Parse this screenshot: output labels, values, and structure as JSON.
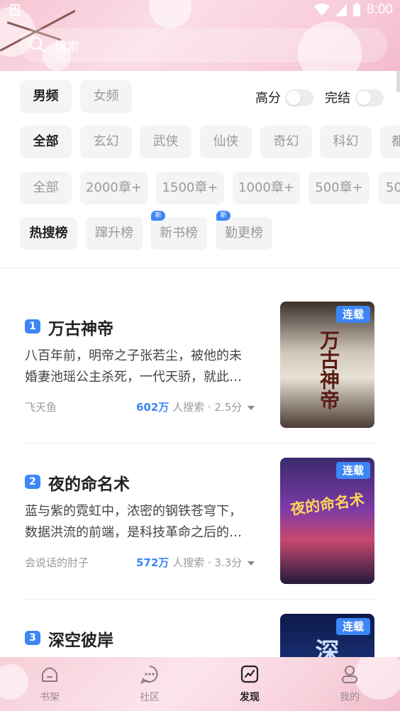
{
  "status_bar": {
    "time": "8:00",
    "left_badge": "A"
  },
  "search": {
    "placeholder": "搜索"
  },
  "filters": {
    "gender": [
      {
        "label": "男频",
        "active": true
      },
      {
        "label": "女频",
        "active": false
      }
    ],
    "toggles": [
      {
        "label": "高分",
        "on": false
      },
      {
        "label": "完结",
        "on": false
      }
    ],
    "categories": [
      "全部",
      "玄幻",
      "武侠",
      "仙侠",
      "奇幻",
      "科幻",
      "都"
    ],
    "chapters": [
      "全部",
      "2000章+",
      "1500章+",
      "1000章+",
      "500章+",
      "50"
    ],
    "rankings": [
      {
        "label": "热搜榜",
        "badge": ""
      },
      {
        "label": "蹿升榜",
        "badge": ""
      },
      {
        "label": "新书榜",
        "badge": "新"
      },
      {
        "label": "勤更榜",
        "badge": "新"
      }
    ]
  },
  "books": [
    {
      "rank": "1",
      "title": "万古神帝",
      "desc_line1": "八百年前，明帝之子张若尘，被他的未",
      "desc_line2": "婚妻池瑶公主杀死，一代天骄，就此…",
      "author": "飞天鱼",
      "searches": "602万",
      "searches_suffix": " 人搜索 · 2.5分",
      "status": "连载",
      "cover_text": "万古神帝"
    },
    {
      "rank": "2",
      "title": "夜的命名术",
      "desc_line1": "蓝与紫的霓虹中，浓密的钢铁苍穹下，",
      "desc_line2": "数据洪流的前端，是科技革命之后的…",
      "author": "会说话的肘子",
      "searches": "572万",
      "searches_suffix": " 人搜索 · 3.3分",
      "status": "连载",
      "cover_text": "夜的命名术"
    },
    {
      "rank": "3",
      "title": "深空彼岸",
      "status": "连载",
      "cover_text": "深"
    }
  ],
  "bottom_nav": [
    {
      "label": "书架",
      "icon": "bookshelf-icon",
      "active": false
    },
    {
      "label": "社区",
      "icon": "community-icon",
      "active": false
    },
    {
      "label": "发现",
      "icon": "discover-icon",
      "active": true
    },
    {
      "label": "我的",
      "icon": "profile-icon",
      "active": false
    }
  ],
  "colors": {
    "accent": "#3d86f5",
    "header_pink": "#f6c6d3"
  }
}
